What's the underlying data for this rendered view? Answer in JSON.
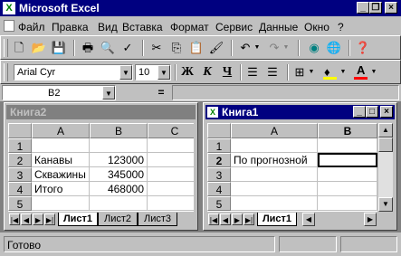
{
  "app": {
    "title": "Microsoft Excel",
    "icon": "excel-icon"
  },
  "menu": [
    "Файл",
    "Правка",
    "Вид",
    "Вставка",
    "Формат",
    "Сервис",
    "Данные",
    "Окно",
    "?"
  ],
  "format_toolbar": {
    "font": "Arial Cyr",
    "size": "10",
    "bold": "Ж",
    "italic": "К",
    "underline": "Ч"
  },
  "formula_bar": {
    "name_box": "B2",
    "equals": "="
  },
  "book2": {
    "title": "Книга2",
    "columns": [
      "A",
      "B",
      "C"
    ],
    "rows": [
      {
        "n": "1",
        "a": "",
        "b": ""
      },
      {
        "n": "2",
        "a": "Канавы",
        "b": "123000"
      },
      {
        "n": "3",
        "a": "Скважины",
        "b": "345000"
      },
      {
        "n": "4",
        "a": "Итого",
        "b": "468000"
      },
      {
        "n": "5",
        "a": "",
        "b": ""
      }
    ],
    "tabs": [
      "Лист1",
      "Лист2",
      "Лист3"
    ]
  },
  "book1": {
    "title": "Книга1",
    "columns": [
      "A",
      "B"
    ],
    "rows": [
      {
        "n": "1",
        "a": "",
        "b": ""
      },
      {
        "n": "2",
        "a": "По прогнозной",
        "b": ""
      },
      {
        "n": "3",
        "a": "",
        "b": ""
      },
      {
        "n": "4",
        "a": "",
        "b": ""
      },
      {
        "n": "5",
        "a": "",
        "b": ""
      }
    ],
    "tabs": [
      "Лист1"
    ]
  },
  "status": {
    "text": "Готово"
  },
  "colors": {
    "title_active": "#000080",
    "title_inactive": "#808080",
    "fill_yellow": "#ffff00",
    "font_red": "#ff0000"
  }
}
